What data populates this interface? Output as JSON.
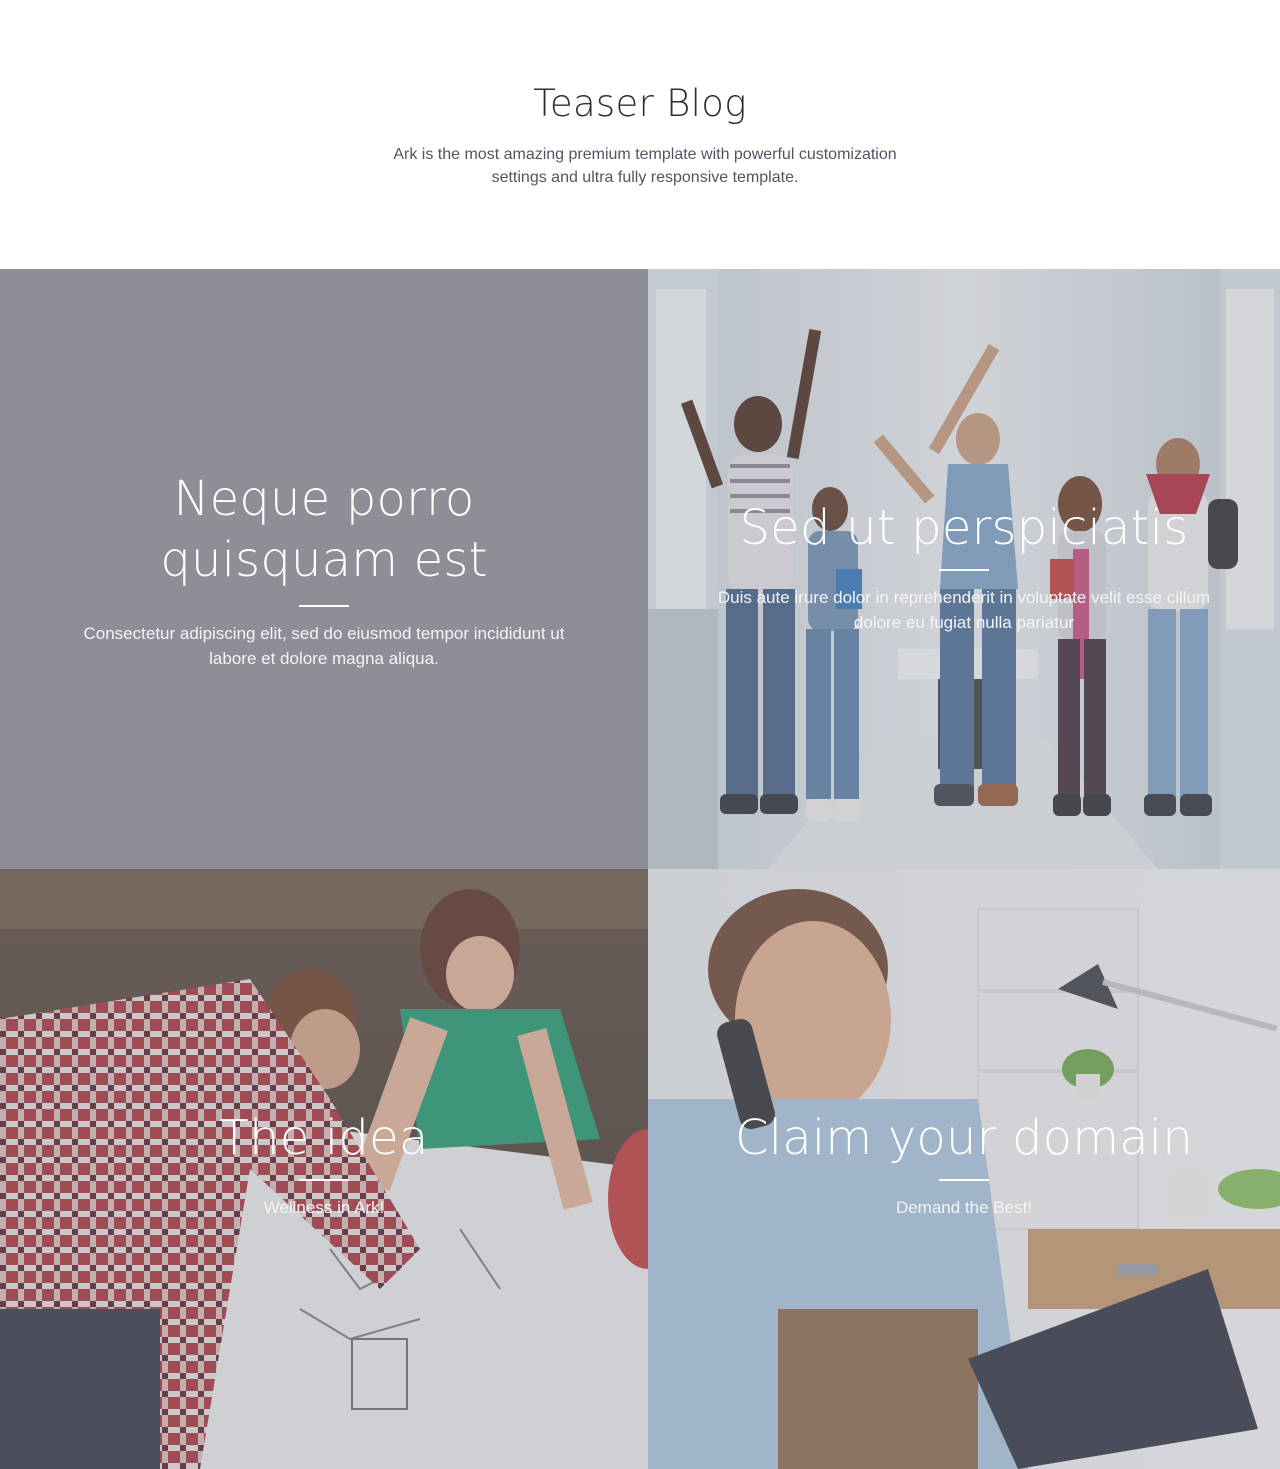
{
  "header": {
    "title": "Teaser Blog",
    "subtitle": "Ark is the most amazing premium template with powerful customization settings and ultra fully responsive template."
  },
  "teasers": [
    {
      "title": "Neque porro quisquam est",
      "text": "Consectetur adipiscing elit, sed do eiusmod tempor incididunt ut labore et dolore magna aliqua.",
      "background": "#8d8e96"
    },
    {
      "title": "Sed ut perspiciatis",
      "text": "Duis aute irure dolor in reprehenderit in voluptate velit esse cillum dolore eu fugiat nulla pariatur",
      "image": "students-jumping-photo"
    },
    {
      "title": "The idea",
      "text": "Wellness in Ark!",
      "image": "team-brainstorm-photo"
    },
    {
      "title": "Claim your domain",
      "text": "Demand the Best!",
      "image": "man-on-phone-photo"
    }
  ],
  "colors": {
    "heading": "#2e2e35",
    "body_text": "#545460",
    "overlay": "#8c8c96",
    "tile_text": "#ffffff"
  }
}
